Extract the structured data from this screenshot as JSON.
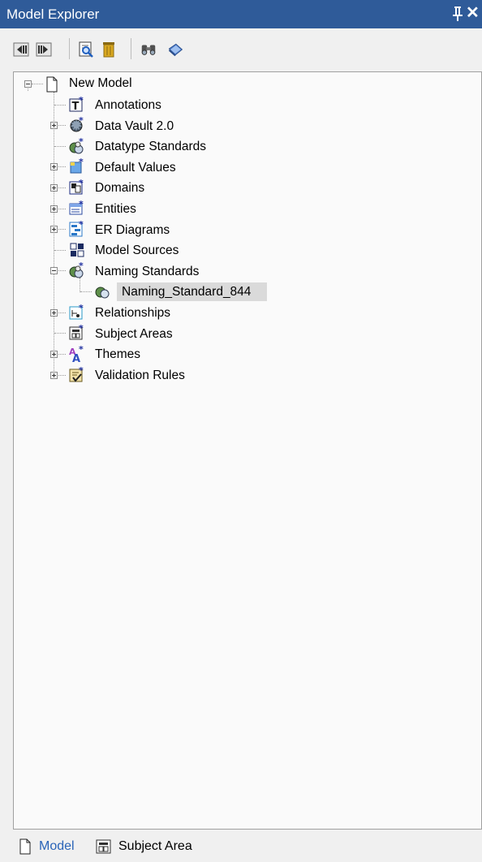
{
  "panel": {
    "title": "Model Explorer",
    "pin_icon": "pin-icon",
    "close_symbol": "✕"
  },
  "toolbar": {
    "buttons": [
      "previous-icon",
      "next-icon",
      "find-icon",
      "delete-icon",
      "search-binoculars-icon",
      "properties-icon"
    ]
  },
  "tree": {
    "root": "New Model",
    "items": [
      {
        "label": "Annotations",
        "icon": "annotations-icon"
      },
      {
        "label": "Data Vault 2.0",
        "icon": "data-vault-icon"
      },
      {
        "label": "Datatype Standards",
        "icon": "datatype-standards-icon"
      },
      {
        "label": "Default Values",
        "icon": "default-values-icon"
      },
      {
        "label": "Domains",
        "icon": "domains-icon"
      },
      {
        "label": "Entities",
        "icon": "entities-icon"
      },
      {
        "label": "ER Diagrams",
        "icon": "er-diagrams-icon"
      },
      {
        "label": "Model Sources",
        "icon": "model-sources-icon"
      },
      {
        "label": "Naming Standards",
        "icon": "naming-standards-icon"
      },
      {
        "label": "Naming_Standard_844",
        "icon": "naming-standard-item-icon"
      },
      {
        "label": "Relationships",
        "icon": "relationships-icon"
      },
      {
        "label": "Subject Areas",
        "icon": "subject-areas-icon"
      },
      {
        "label": "Themes",
        "icon": "themes-icon"
      },
      {
        "label": "Validation Rules",
        "icon": "validation-rules-icon"
      }
    ]
  },
  "bottom_tabs": [
    {
      "label": "Model",
      "active": true
    },
    {
      "label": "Subject Area",
      "active": false
    }
  ],
  "colors": {
    "title_bar": "#2f5b99",
    "selection": "#dadada",
    "active_tab_text": "#2a64b8"
  }
}
